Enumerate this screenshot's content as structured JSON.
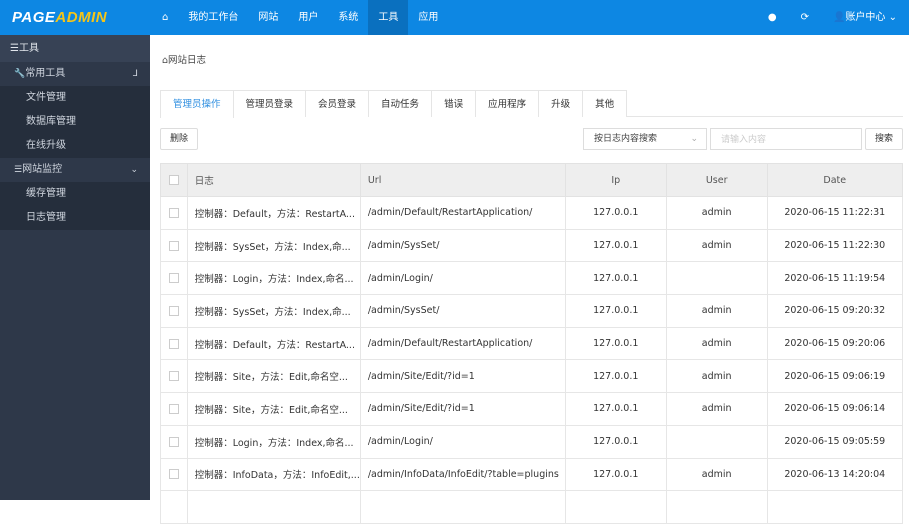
{
  "header": {
    "logo_a": "PAGE",
    "logo_b": "ADMIN",
    "nav": [
      "我的工作台",
      "网站",
      "用户",
      "系统",
      "工具",
      "应用"
    ],
    "active_nav": "工具",
    "account": "账户中心",
    "brand_color": "#0d87e3"
  },
  "sidebar": {
    "title": "工具",
    "groups": [
      {
        "label": "常用工具",
        "icon": "wrench-icon",
        "items": [
          "文件管理",
          "数据库管理",
          "在线升级"
        ]
      },
      {
        "label": "网站监控",
        "icon": "list-icon",
        "items": [
          "缓存管理",
          "日志管理"
        ]
      }
    ]
  },
  "breadcrumb": "网站日志",
  "tabs": [
    "管理员操作",
    "管理员登录",
    "会员登录",
    "自动任务",
    "错误",
    "应用程序",
    "升级",
    "其他"
  ],
  "toolbar": {
    "delete": "删除",
    "search_type": "按日志内容搜索",
    "search_placeholder": "请输入内容",
    "search": "搜索"
  },
  "table": {
    "columns": [
      "日志",
      "Url",
      "Ip",
      "User",
      "Date"
    ],
    "rows": [
      [
        "控制器：Default，方法：RestartA...",
        "/admin/Default/RestartApplication/",
        "127.0.0.1",
        "admin",
        "2020-06-15 11:22:31"
      ],
      [
        "控制器：SysSet，方法：Index,命...",
        "/admin/SysSet/",
        "127.0.0.1",
        "admin",
        "2020-06-15 11:22:30"
      ],
      [
        "控制器：Login，方法：Index,命名...",
        "/admin/Login/",
        "127.0.0.1",
        "",
        "2020-06-15 11:19:54"
      ],
      [
        "控制器：SysSet，方法：Index,命...",
        "/admin/SysSet/",
        "127.0.0.1",
        "admin",
        "2020-06-15 09:20:32"
      ],
      [
        "控制器：Default，方法：RestartA...",
        "/admin/Default/RestartApplication/",
        "127.0.0.1",
        "admin",
        "2020-06-15 09:20:06"
      ],
      [
        "控制器：Site，方法：Edit,命名空...",
        "/admin/Site/Edit/?id=1",
        "127.0.0.1",
        "admin",
        "2020-06-15 09:06:19"
      ],
      [
        "控制器：Site，方法：Edit,命名空...",
        "/admin/Site/Edit/?id=1",
        "127.0.0.1",
        "admin",
        "2020-06-15 09:06:14"
      ],
      [
        "控制器：Login，方法：Index,命名...",
        "/admin/Login/",
        "127.0.0.1",
        "",
        "2020-06-15 09:05:59"
      ],
      [
        "控制器：InfoData，方法：InfoEdit,...",
        "/admin/InfoData/InfoEdit/?table=plugins",
        "127.0.0.1",
        "admin",
        "2020-06-13 14:20:04"
      ]
    ]
  }
}
